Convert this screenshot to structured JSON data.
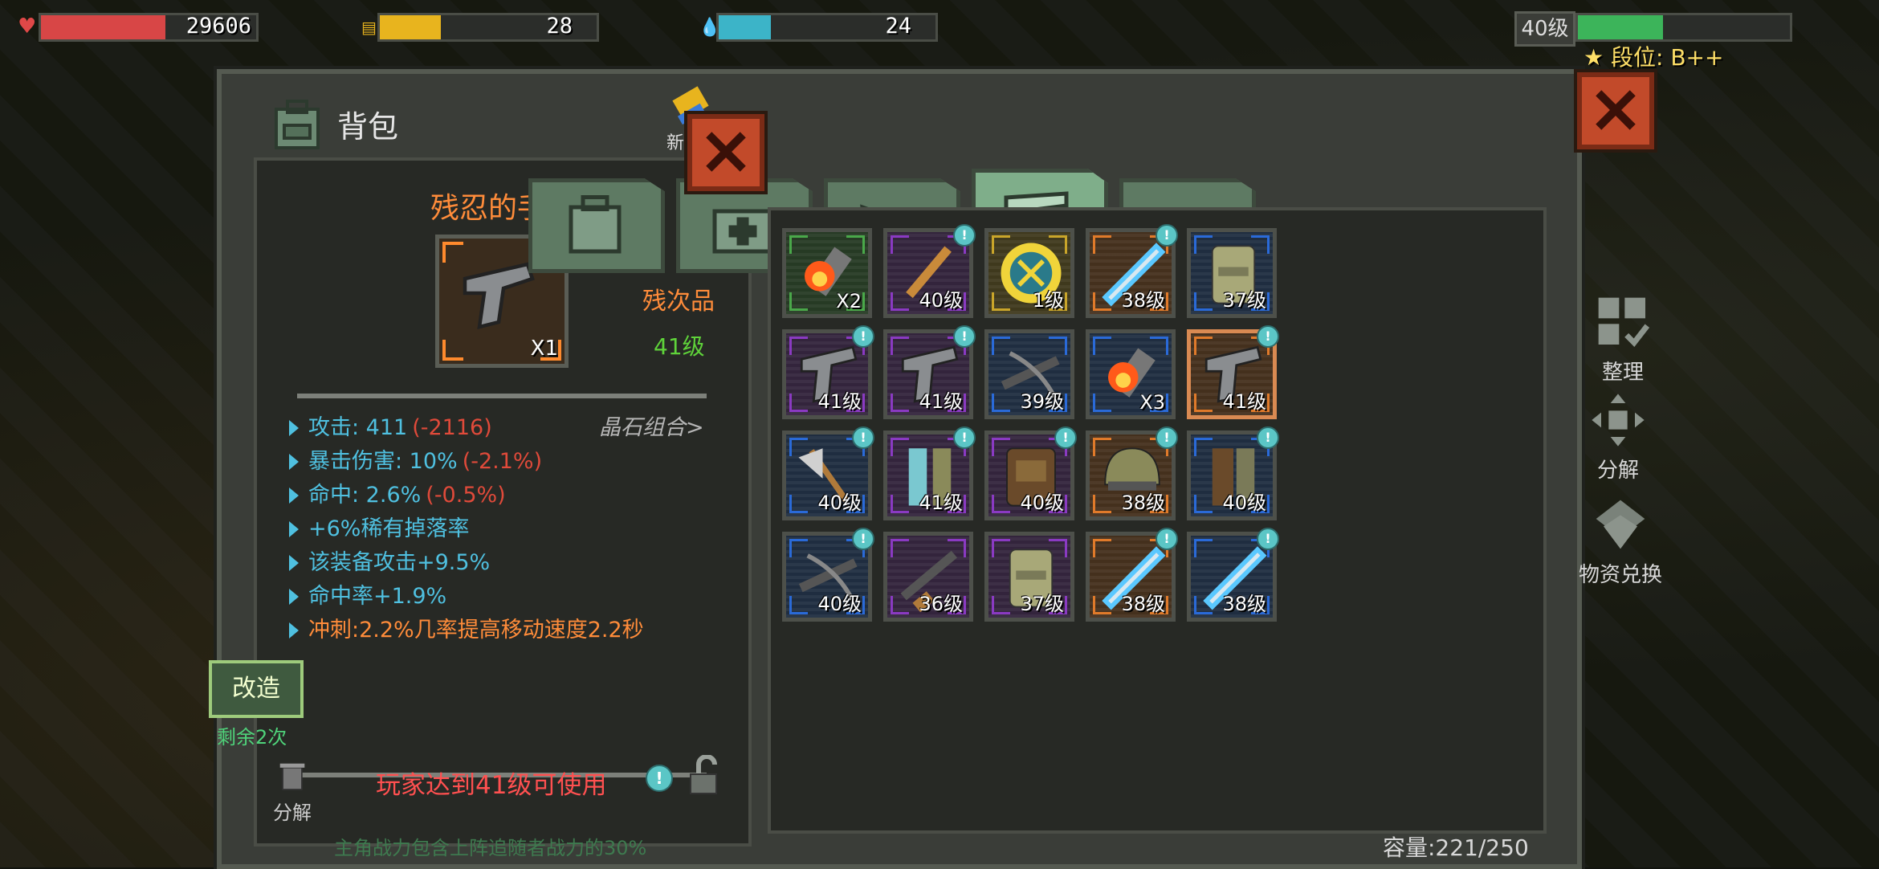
{
  "hud": {
    "hp": {
      "value": "29606",
      "fill": 0.58,
      "color": "#d84646"
    },
    "food": {
      "value": "28",
      "fill": 0.28,
      "color": "#e8b41e"
    },
    "water": {
      "value": "24",
      "fill": 0.24,
      "color": "#3cb4c8"
    },
    "level": {
      "label": "40级",
      "fill": 0.4,
      "color": "#3cb45a"
    },
    "rank": "段位: B++"
  },
  "panel": {
    "title": "背包",
    "new_label": "新"
  },
  "item_detail": {
    "name": "残忍的手枪",
    "qty": "X1",
    "rarity": "残次品",
    "level": "41级",
    "crystal_link": "晶石组合>",
    "stats": [
      {
        "label": "攻击: 411",
        "delta": "(-2116)",
        "color": "#4fc0e0"
      },
      {
        "label": "暴击伤害: 10%",
        "delta": "(-2.1%)",
        "color": "#4fc0e0"
      },
      {
        "label": "命中: 2.6%",
        "delta": "(-0.5%)",
        "color": "#4fc0e0"
      },
      {
        "label": "+6%稀有掉落率",
        "delta": "",
        "color": "#4fc0e0"
      },
      {
        "label": "该装备攻击+9.5%",
        "delta": "",
        "color": "#4fc0e0"
      },
      {
        "label": "命中率+1.9%",
        "delta": "",
        "color": "#4fc0e0"
      },
      {
        "label": "冲刺:2.2%几率提高移动速度2.2秒",
        "delta": "",
        "color": "#ff8c3a"
      }
    ],
    "modify_button": "改造",
    "modify_remaining": "剩余2次",
    "dismantle_label": "分解",
    "requirement": "玩家达到41级可使用",
    "footer_note": "主角战力包含上阵追随者战力的30%"
  },
  "tabs": [
    "backpack-tab-icon",
    "medkit-tab-icon",
    "wing-tab-icon",
    "gun-tab-icon",
    "wrench-tab-icon"
  ],
  "active_tab": 3,
  "grid": {
    "items": [
      {
        "icon": "fire-bomb-icon",
        "label": "X2",
        "rarity": "green",
        "dot": false
      },
      {
        "icon": "bat-icon",
        "label": "40级",
        "rarity": "purple",
        "dot": true
      },
      {
        "icon": "gear-core-icon",
        "label": "1级",
        "rarity": "gold",
        "dot": false
      },
      {
        "icon": "lightning-blade-icon",
        "label": "38级",
        "rarity": "orange",
        "dot": true
      },
      {
        "icon": "vest-icon",
        "label": "37级",
        "rarity": "blue",
        "dot": false
      },
      {
        "icon": "pistol-icon",
        "label": "41级",
        "rarity": "purple",
        "dot": true
      },
      {
        "icon": "pistol-icon",
        "label": "41级",
        "rarity": "purple",
        "dot": true
      },
      {
        "icon": "crossbow-icon",
        "label": "39级",
        "rarity": "blue",
        "dot": false
      },
      {
        "icon": "fire-bomb-icon",
        "label": "X3",
        "rarity": "blue",
        "dot": false
      },
      {
        "icon": "pistol-icon",
        "label": "41级",
        "rarity": "orange",
        "dot": true
      },
      {
        "icon": "axe-icon",
        "label": "40级",
        "rarity": "blue",
        "dot": true
      },
      {
        "icon": "armor-pants-icon",
        "label": "41级",
        "rarity": "purple",
        "dot": true
      },
      {
        "icon": "backpack-armor-icon",
        "label": "40级",
        "rarity": "purple",
        "dot": true
      },
      {
        "icon": "helmet-icon",
        "label": "38级",
        "rarity": "orange",
        "dot": true
      },
      {
        "icon": "leg-armor-icon",
        "label": "40级",
        "rarity": "blue",
        "dot": true
      },
      {
        "icon": "crossbow-icon",
        "label": "40级",
        "rarity": "blue",
        "dot": true
      },
      {
        "icon": "rifle-icon",
        "label": "36级",
        "rarity": "purple",
        "dot": false
      },
      {
        "icon": "vest-icon",
        "label": "37级",
        "rarity": "purple",
        "dot": false
      },
      {
        "icon": "lightning-blade-icon",
        "label": "38级",
        "rarity": "orange",
        "dot": true
      },
      {
        "icon": "lightning-blade-icon",
        "label": "38级",
        "rarity": "blue",
        "dot": true
      }
    ],
    "capacity": "容量:221/250"
  },
  "side_buttons": [
    {
      "label": "整理",
      "icon": "sort-icon"
    },
    {
      "label": "分解",
      "icon": "dismantle-icon"
    },
    {
      "label": "物资兑换",
      "icon": "exchange-icon"
    }
  ],
  "colors": {
    "green": "#4aa84a",
    "purple": "#8a3ac2",
    "gold": "#c9a52a",
    "orange": "#e07a2a",
    "blue": "#2a6ad8"
  }
}
